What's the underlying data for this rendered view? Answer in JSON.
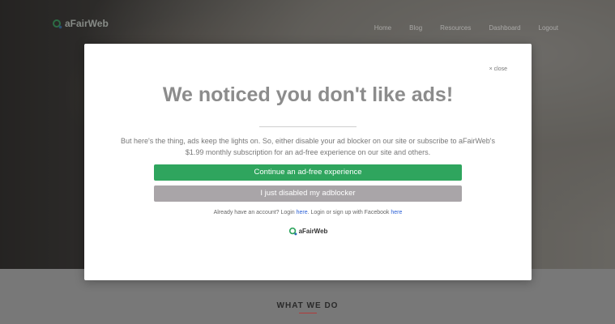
{
  "site": {
    "logo_text": "aFairWeb",
    "nav": [
      "Home",
      "Blog",
      "Resources",
      "Dashboard",
      "Logout"
    ],
    "section_title": "WHAT WE DO"
  },
  "modal": {
    "close_label": "× close",
    "title": "We noticed you don't like ads!",
    "body_line1": "But here's the thing, ads keep the lights on. So, either disable your ad blocker on our site or subscribe to aFairWeb's",
    "body_line2": "$1.99 monthly subscription for an ad-free experience on our site and others.",
    "primary_button": "Continue an ad-free experience",
    "secondary_button": "I just disabled my adblocker",
    "account_text_1": "Already have an account? Login ",
    "account_link_1": "here",
    "account_text_2": ". Login or sign up with Facebook ",
    "account_link_2": "here",
    "logo_text": "aFairWeb"
  },
  "colors": {
    "primary_button": "#2fa55e",
    "secondary_button": "#a9a5a8",
    "link": "#2a5fd6"
  }
}
